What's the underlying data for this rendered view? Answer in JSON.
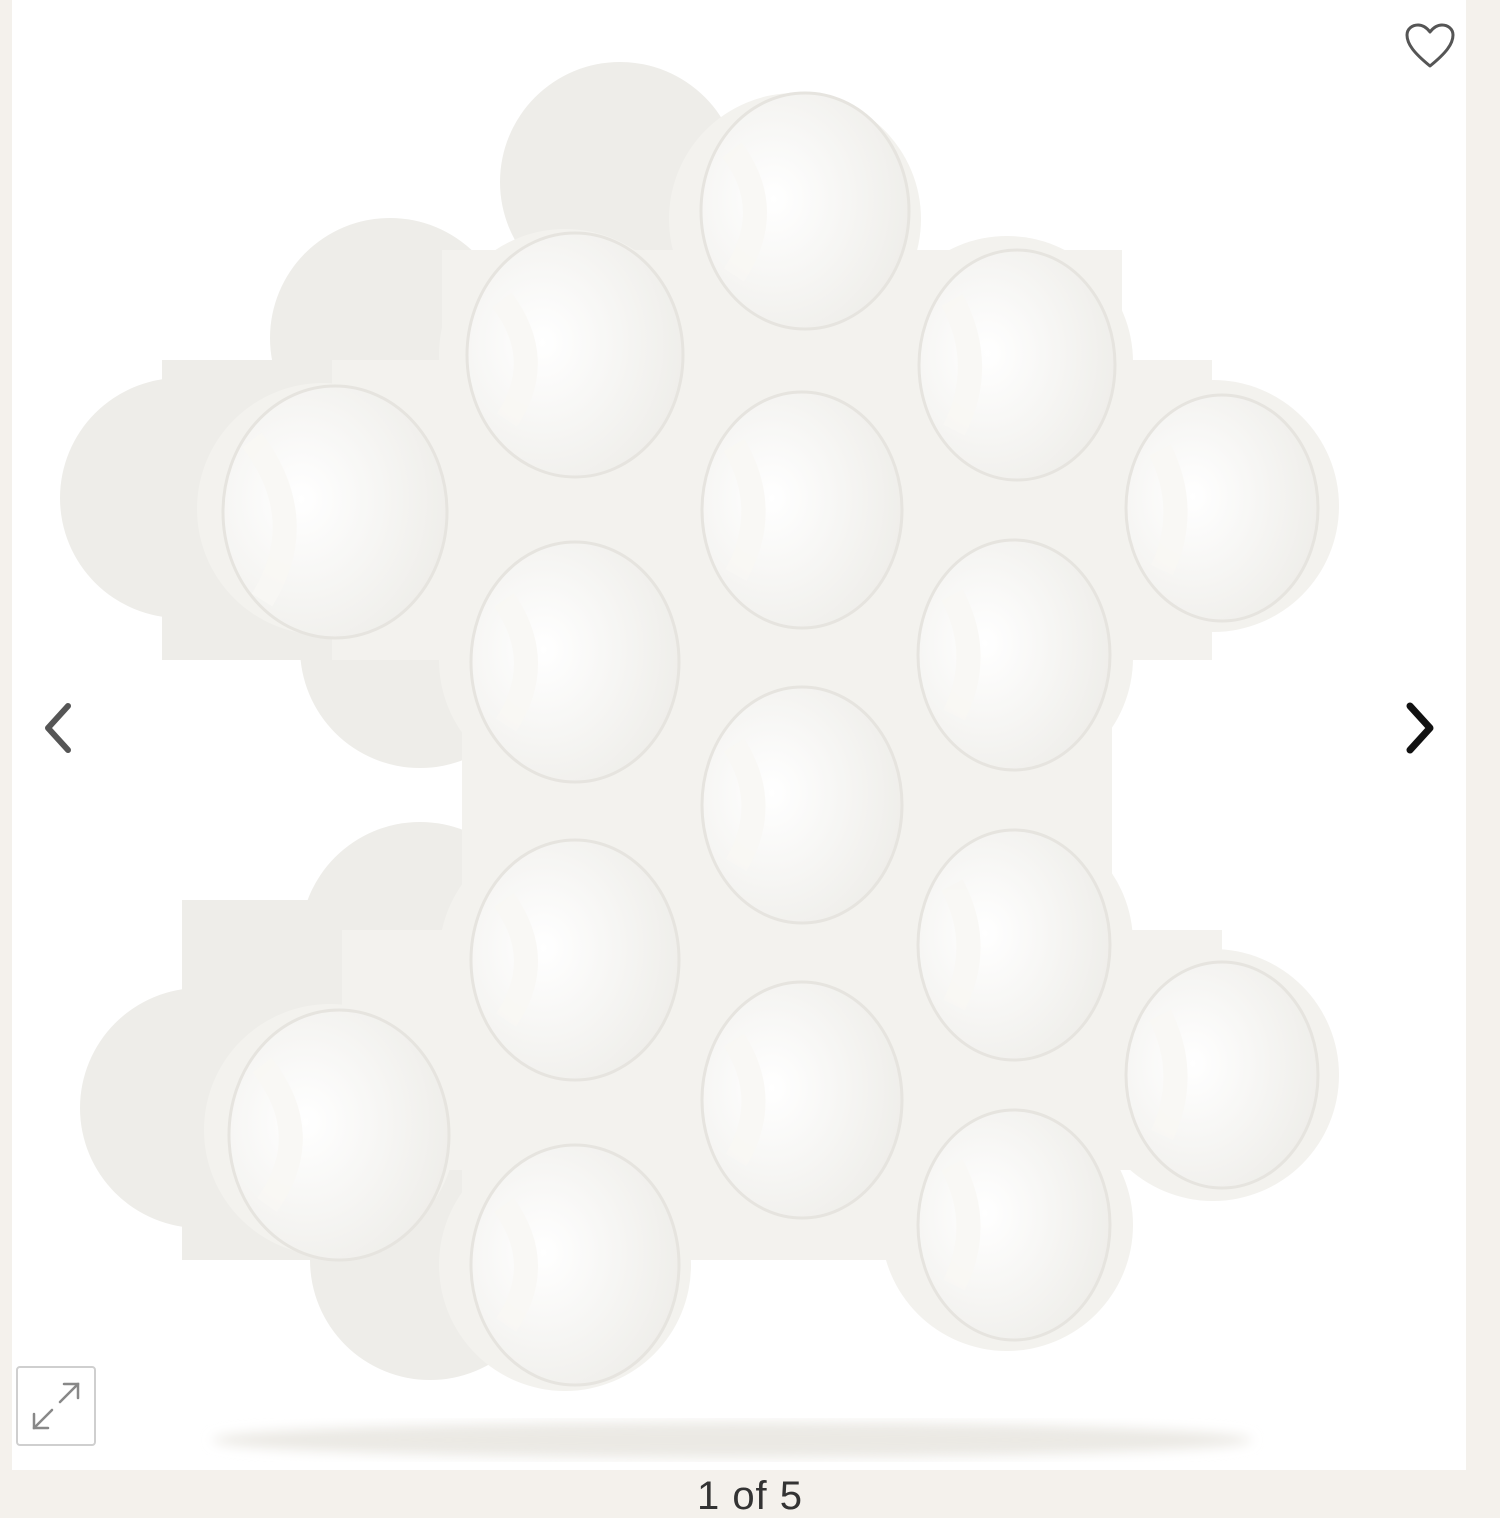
{
  "gallery": {
    "counter": {
      "current": "1",
      "separator": "of",
      "total": "5"
    },
    "icons": {
      "favorite": "heart-icon",
      "previous": "chevron-left-icon",
      "next": "chevron-right-icon",
      "expand": "expand-icon"
    },
    "colors": {
      "page_background": "#f4f1ec",
      "image_background": "#ffffff",
      "product": "#f3f2ee",
      "icon": "#555555"
    }
  }
}
